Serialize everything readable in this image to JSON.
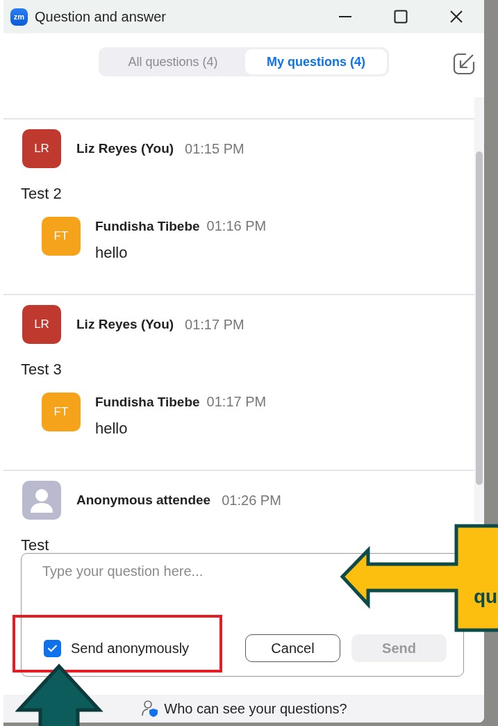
{
  "window": {
    "logo": "zm",
    "title": "Question and answer"
  },
  "tabs": [
    {
      "label": "All questions (4)",
      "selected": false
    },
    {
      "label": "My questions (4)",
      "selected": true
    }
  ],
  "questions": [
    {
      "kind": "member",
      "author": "Liz Reyes (You)",
      "initials": "LR",
      "color": "#c0392f",
      "time": "01:15 PM",
      "text": "Test 2",
      "answers": [
        {
          "author": "Fundisha Tibebe",
          "initials": "FT",
          "color": "#f5a31a",
          "time": "01:16 PM",
          "text": "hello"
        }
      ]
    },
    {
      "kind": "member",
      "author": "Liz Reyes (You)",
      "initials": "LR",
      "color": "#c0392f",
      "time": "01:17 PM",
      "text": "Test 3",
      "answers": [
        {
          "author": "Fundisha Tibebe",
          "initials": "FT",
          "color": "#f5a31a",
          "time": "01:17 PM",
          "text": "hello"
        }
      ]
    },
    {
      "kind": "anonymous",
      "author": "Anonymous attendee",
      "time": "01:26 PM",
      "text": "Test"
    }
  ],
  "composer": {
    "placeholder": "Type your question here...",
    "anonymous": {
      "label": "Send anonymously",
      "checked": true
    },
    "buttons": [
      {
        "label": "Cancel",
        "disabled": false
      },
      {
        "label": "Send",
        "disabled": true
      }
    ]
  },
  "footer": {
    "text": "Who can see your questions?"
  },
  "annotations": [
    {
      "kind": "left-arrow",
      "text": "qu"
    },
    {
      "kind": "highlight-box"
    },
    {
      "kind": "up-arrow"
    }
  ]
}
